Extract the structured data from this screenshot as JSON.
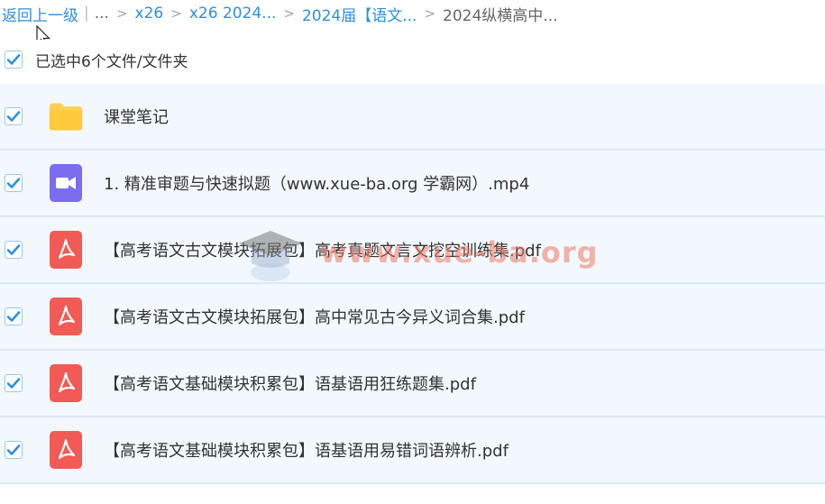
{
  "breadcrumb": {
    "back": "返回上一级",
    "pipe": "|",
    "ellipsis": "...",
    "crumbs": [
      "x26",
      "x26 2024...",
      "2024届【语文..."
    ],
    "current": "2024纵横高中..."
  },
  "selection": {
    "label": "已选中6个文件/文件夹"
  },
  "files": [
    {
      "name": "课堂笔记",
      "type": "folder"
    },
    {
      "name": "1. 精准审题与快速拟题（www.xue-ba.org 学霸网）.mp4",
      "type": "video"
    },
    {
      "name": "【高考语文古文模块拓展包】高考真题文言文挖空训练集.pdf",
      "type": "pdf"
    },
    {
      "name": "【高考语文古文模块拓展包】高中常见古今异义词合集.pdf",
      "type": "pdf"
    },
    {
      "name": "【高考语文基础模块积累包】语基语用狂练题集.pdf",
      "type": "pdf"
    },
    {
      "name": "【高考语文基础模块积累包】语基语用易错词语辨析.pdf",
      "type": "pdf"
    }
  ],
  "watermark": "www.xue-ba.org",
  "colors": {
    "link": "#2e8fe0",
    "row_bg": "#f2f8fd",
    "check": "#2e8fe0",
    "folder": "#ffd052",
    "video": "#7b6cf0",
    "pdf": "#f25a55"
  },
  "icons": {
    "folder": "folder-icon",
    "video": "video-icon",
    "pdf": "pdf-icon",
    "check": "checkmark-icon",
    "cursor": "mouse-cursor-icon"
  }
}
